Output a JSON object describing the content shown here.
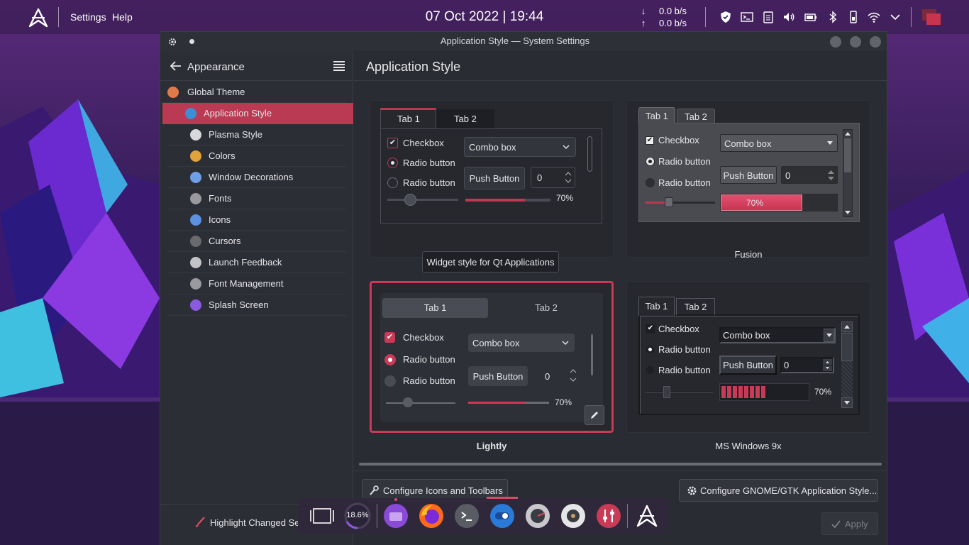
{
  "panel": {
    "menu": [
      "Settings",
      "Help"
    ],
    "clock": "07 Oct 2022 | 19:44",
    "net_down": "0.0 b/s",
    "net_up": "0.0 b/s"
  },
  "window": {
    "title": "Application Style — System Settings"
  },
  "sidebar": {
    "header": "Appearance",
    "items": [
      {
        "label": "Global Theme",
        "icon": "global-theme-icon",
        "color": "#e07a4a"
      },
      {
        "label": "Application Style",
        "icon": "application-style-icon",
        "color": "#3b8fd4",
        "selected": true
      },
      {
        "label": "Plasma Style",
        "icon": "plasma-style-icon",
        "color": "#d8d8dc"
      },
      {
        "label": "Colors",
        "icon": "colors-icon",
        "color": "#e0a23a"
      },
      {
        "label": "Window Decorations",
        "icon": "window-decorations-icon",
        "color": "#6f9fe6"
      },
      {
        "label": "Fonts",
        "icon": "fonts-icon",
        "color": "#9a9a9e"
      },
      {
        "label": "Icons",
        "icon": "icons-icon",
        "color": "#5b8fe0"
      },
      {
        "label": "Cursors",
        "icon": "cursors-icon",
        "color": "#6a6a6e"
      },
      {
        "label": "Launch Feedback",
        "icon": "launch-feedback-icon",
        "color": "#c4c4c8"
      },
      {
        "label": "Font Management",
        "icon": "font-management-icon",
        "color": "#9a9a9e"
      },
      {
        "label": "Splash Screen",
        "icon": "splash-screen-icon",
        "color": "#8a5be0"
      }
    ],
    "highlight_changed": "Highlight Changed Se"
  },
  "main": {
    "title": "Application Style",
    "tooltip": "Widget style for Qt Applications",
    "styles": [
      {
        "caption": "",
        "selected": false
      },
      {
        "caption": "Fusion",
        "selected": false
      },
      {
        "caption": "Lightly",
        "selected": true
      },
      {
        "caption": "MS Windows 9x",
        "selected": false
      }
    ],
    "preview": {
      "tab1": "Tab 1",
      "tab2": "Tab 2",
      "checkbox": "Checkbox",
      "radio1": "Radio button",
      "radio2": "Radio button",
      "combo": "Combo box",
      "push": "Push Button",
      "spin": "0",
      "progress_label": "70%",
      "progress_value": 0.7
    },
    "configure_icons": "Configure Icons and Toolbars",
    "configure_gtk": "Configure GNOME/GTK Application Style...",
    "apply": "Apply"
  },
  "dock": {
    "cpu": "18.6%",
    "apps": [
      "overview-icon",
      "cpu-monitor",
      "file-manager-icon",
      "firefox-icon",
      "terminal-icon",
      "settings-toggle-icon",
      "disk-usage-icon",
      "audio-disc-icon",
      "mixer-icon",
      "launcher-icon"
    ]
  },
  "colors": {
    "accent": "#b93a52",
    "background": "#2a2c33"
  }
}
